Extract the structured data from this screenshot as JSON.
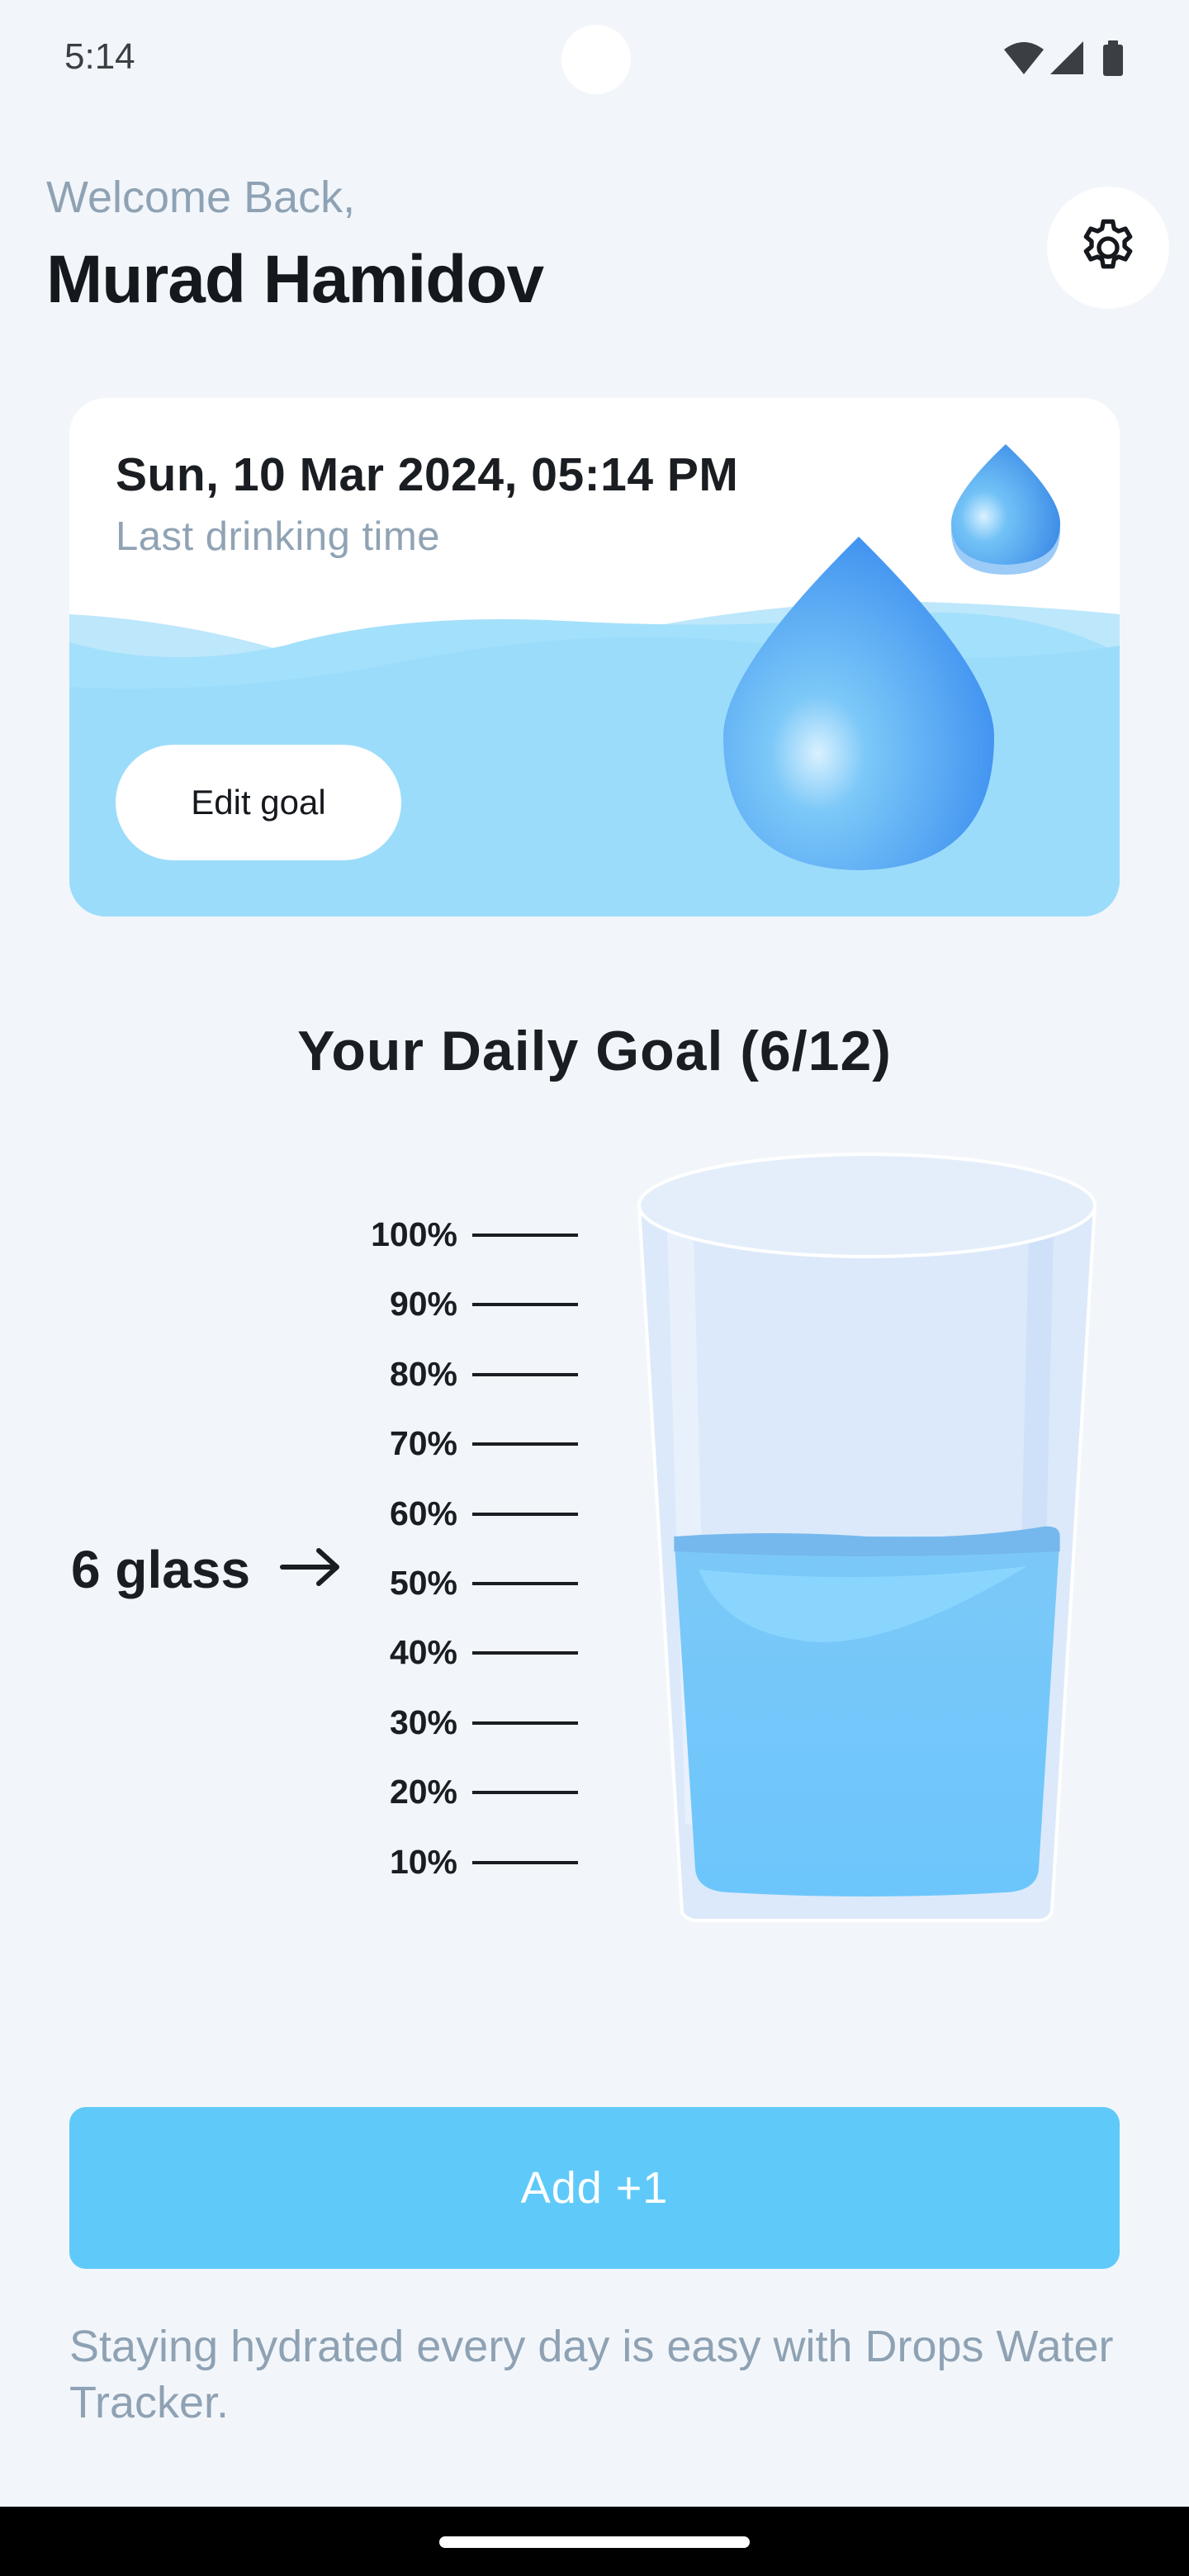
{
  "status_bar": {
    "time": "5:14",
    "icons": [
      "wifi-icon",
      "cell-signal-icon",
      "battery-icon"
    ]
  },
  "header": {
    "welcome": "Welcome Back,",
    "user_name": "Murad Hamidov",
    "settings_icon": "gear-icon"
  },
  "last_drink_card": {
    "datetime": "Sun, 10 Mar 2024, 05:14 PM",
    "subtitle": "Last drinking time",
    "edit_goal_label": "Edit goal"
  },
  "daily_goal": {
    "title": "Your Daily Goal (6/12)",
    "consumed": 6,
    "target": 12,
    "fill_percent": 50,
    "level_label": "6 glass",
    "scale": [
      "100%",
      "90%",
      "80%",
      "70%",
      "60%",
      "50%",
      "40%",
      "30%",
      "20%",
      "10%"
    ]
  },
  "add_button_label": "Add +1",
  "footer_text": "Staying hydrated every day is easy with Drops Water Tracker.",
  "colors": {
    "accent": "#5fcaf9",
    "background": "#f2f6fa",
    "muted_text": "#8fa2b4",
    "water": "#7cc8f8"
  }
}
